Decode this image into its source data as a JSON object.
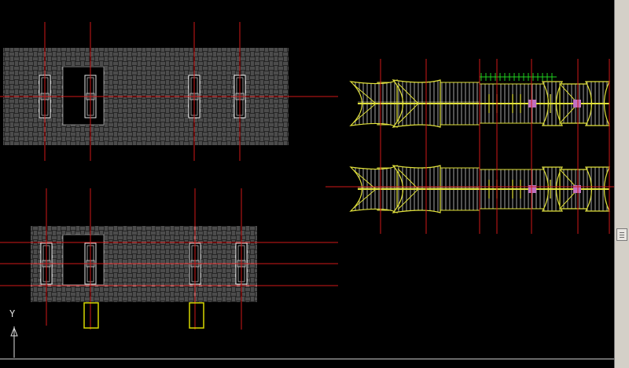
{
  "app": {
    "view": "cad-model-space"
  },
  "ucs": {
    "y_axis_label": "Y"
  },
  "colors": {
    "background": "#000000",
    "hatch": "#bdbdbd",
    "centerline": "#d01818",
    "roof_outline": "#e2e23a",
    "highlight_box": "#d8d800",
    "marker_magenta": "#c070c0",
    "marker_green": "#20d020"
  },
  "icons": {
    "ucs": "ucs-axis-icon",
    "scroll_thumb": "scroll-thumb-grip-icon"
  },
  "scroll": {
    "vertical_position": 0.62
  }
}
